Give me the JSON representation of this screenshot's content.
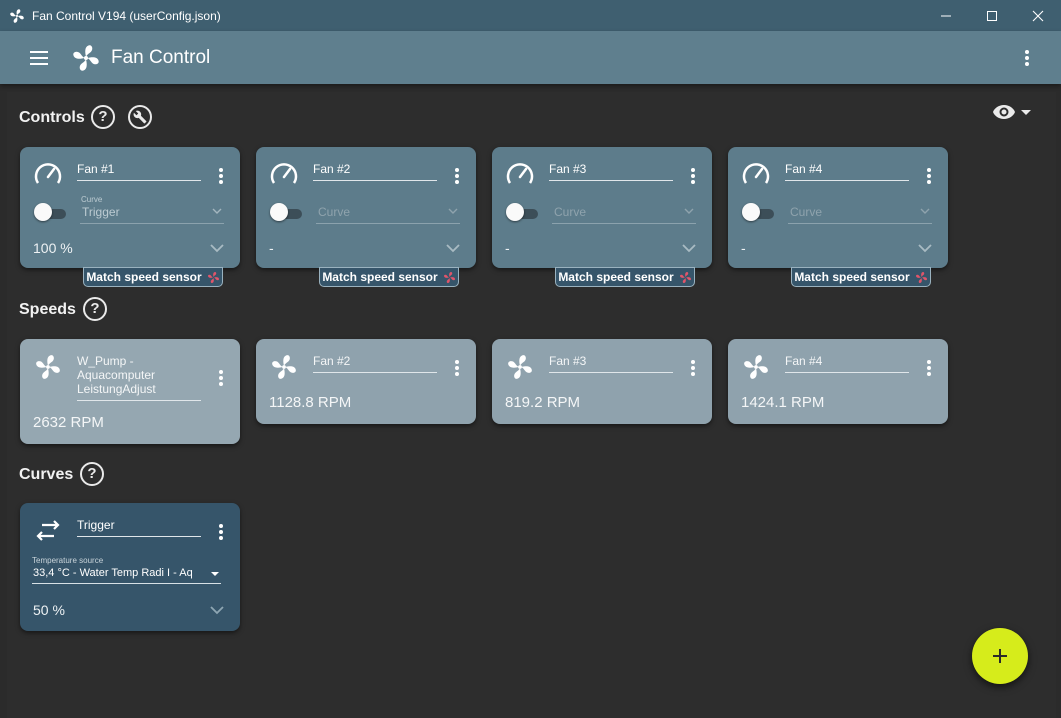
{
  "window": {
    "title": "Fan Control V194 (userConfig.json)"
  },
  "appbar": {
    "title": "Fan Control"
  },
  "sections": {
    "controls": "Controls",
    "speeds": "Speeds",
    "curves": "Curves"
  },
  "help_glyph": "?",
  "controls": [
    {
      "name": "Fan #1",
      "curve_label": "Curve",
      "curve": "Trigger",
      "value": "100 %",
      "badge": "Match speed sensor",
      "enabled": false
    },
    {
      "name": "Fan #2",
      "curve_label": "",
      "curve": "Curve",
      "value": "-",
      "badge": "Match speed sensor",
      "enabled": false
    },
    {
      "name": "Fan #3",
      "curve_label": "",
      "curve": "Curve",
      "value": "-",
      "badge": "Match speed sensor",
      "enabled": false
    },
    {
      "name": "Fan #4",
      "curve_label": "",
      "curve": "Curve",
      "value": "-",
      "badge": "Match speed sensor",
      "enabled": false
    }
  ],
  "speeds": [
    {
      "name": "W_Pump - Aquacomputer LeistungAdjust",
      "value": "2632 RPM"
    },
    {
      "name": "Fan #2",
      "value": "1128.8 RPM"
    },
    {
      "name": "Fan #3",
      "value": "819.2 RPM"
    },
    {
      "name": "Fan #4",
      "value": "1424.1 RPM"
    }
  ],
  "curves": [
    {
      "name": "Trigger",
      "source_label": "Temperature source",
      "source": "33,4 °C - Water Temp Radi I - Aq",
      "value": "50 %"
    }
  ],
  "colors": {
    "accent_fab": "#d6ec1b",
    "titlebar": "#3f5f70",
    "appbar": "#5f7f8e",
    "badge_icon": "#e0556a"
  }
}
